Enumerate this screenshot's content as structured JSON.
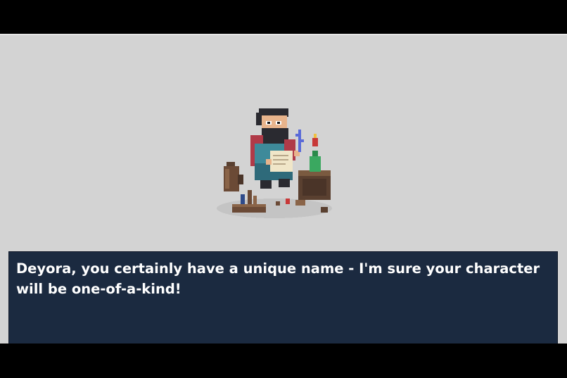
{
  "scene": {
    "character": "pixel-art-scholar-sprite"
  },
  "dialog": {
    "text": "Deyora, you certainly have a unique name - I'm sure your character will be one-of-a-kind!"
  },
  "colors": {
    "stage_background": "#d3d3d3",
    "dialog_background": "#1b2a40",
    "dialog_text": "#ffffff",
    "letterbox": "#000000"
  }
}
